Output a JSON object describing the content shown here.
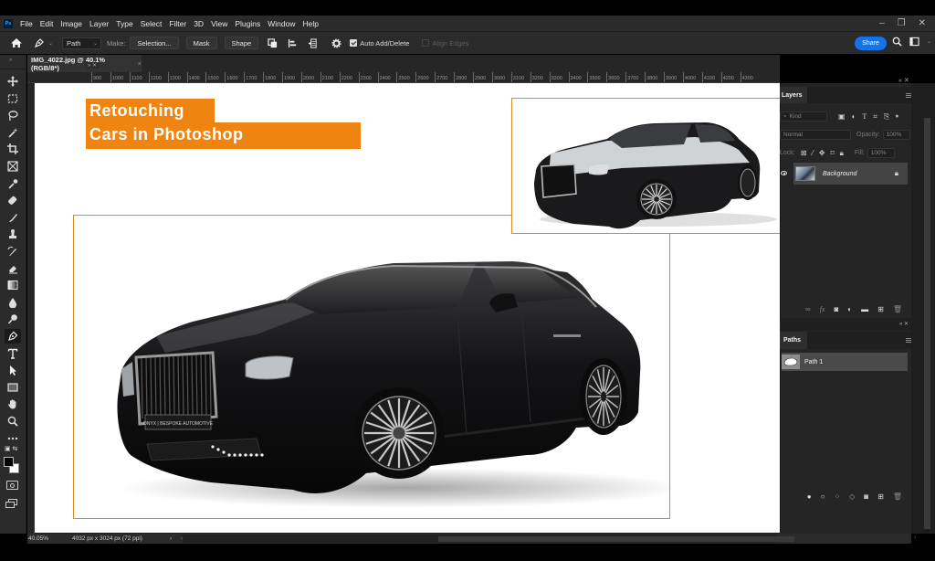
{
  "app": {
    "name": "Adobe Photoshop",
    "logo_text": "Ps"
  },
  "menu": {
    "items": [
      "File",
      "Edit",
      "Image",
      "Layer",
      "Type",
      "Select",
      "Filter",
      "3D",
      "View",
      "Plugins",
      "Window",
      "Help"
    ]
  },
  "window_controls": {
    "minimize": "–",
    "restore": "❐",
    "close": "✕"
  },
  "options_bar": {
    "mode_value": "Path",
    "make_label": "Make:",
    "selection_button": "Selection...",
    "mask_button": "Mask",
    "shape_button": "Shape",
    "auto_add_delete_label": "Auto Add/Delete",
    "auto_add_delete_checked": true,
    "align_edges_label": "Align Edges",
    "align_edges_checked": false,
    "share_button": "Share"
  },
  "document": {
    "tab_title": "IMG_4022.jpg @ 40.1% (RGB/8*)",
    "tab_close": "×",
    "zoom_level": "40.05%",
    "dimensions": "4032 px x 3024 px (72 ppi)"
  },
  "ruler": {
    "ticks": [
      "900",
      "1000",
      "1100",
      "1200",
      "1300",
      "1400",
      "1500",
      "1600",
      "1700",
      "1800",
      "1900",
      "2000",
      "2100",
      "2200",
      "2300",
      "2400",
      "2500",
      "2600",
      "2700",
      "2800",
      "2900",
      "3000",
      "3100",
      "3200",
      "3300",
      "3400",
      "3500",
      "3600",
      "3700",
      "3800",
      "3900",
      "4000",
      "4100",
      "4200",
      "4300"
    ]
  },
  "canvas": {
    "title_line1": "Retouching",
    "title_line2": "Cars in Photoshop",
    "accent_color": "#ef8510",
    "frame_color": "#d98a25",
    "plate_text": "ONYX | BESPOKE AUTOMOTIVE"
  },
  "tools": [
    {
      "name": "move-tool"
    },
    {
      "name": "marquee-tool"
    },
    {
      "name": "lasso-tool"
    },
    {
      "name": "magic-wand-tool"
    },
    {
      "name": "crop-tool"
    },
    {
      "name": "frame-tool"
    },
    {
      "name": "eyedropper-tool"
    },
    {
      "name": "healing-brush-tool"
    },
    {
      "name": "brush-tool"
    },
    {
      "name": "clone-stamp-tool"
    },
    {
      "name": "history-brush-tool"
    },
    {
      "name": "eraser-tool"
    },
    {
      "name": "gradient-tool"
    },
    {
      "name": "blur-tool"
    },
    {
      "name": "dodge-tool"
    },
    {
      "name": "pen-tool",
      "active": true
    },
    {
      "name": "type-tool"
    },
    {
      "name": "path-selection-tool"
    },
    {
      "name": "rectangle-tool"
    },
    {
      "name": "hand-tool"
    },
    {
      "name": "zoom-tool"
    },
    {
      "name": "more-tools"
    }
  ],
  "layers_panel": {
    "tab_label": "Layers",
    "filter_kind": "Kind",
    "blend_mode": "Normal",
    "opacity_label": "Opacity:",
    "opacity_value": "100%",
    "lock_label": "Lock:",
    "fill_label": "Fill:",
    "fill_value": "100%",
    "layers": [
      {
        "name": "Background",
        "visible": true,
        "locked": true
      }
    ]
  },
  "paths_panel": {
    "tab_label": "Paths",
    "paths": [
      {
        "name": "Path 1"
      }
    ]
  }
}
